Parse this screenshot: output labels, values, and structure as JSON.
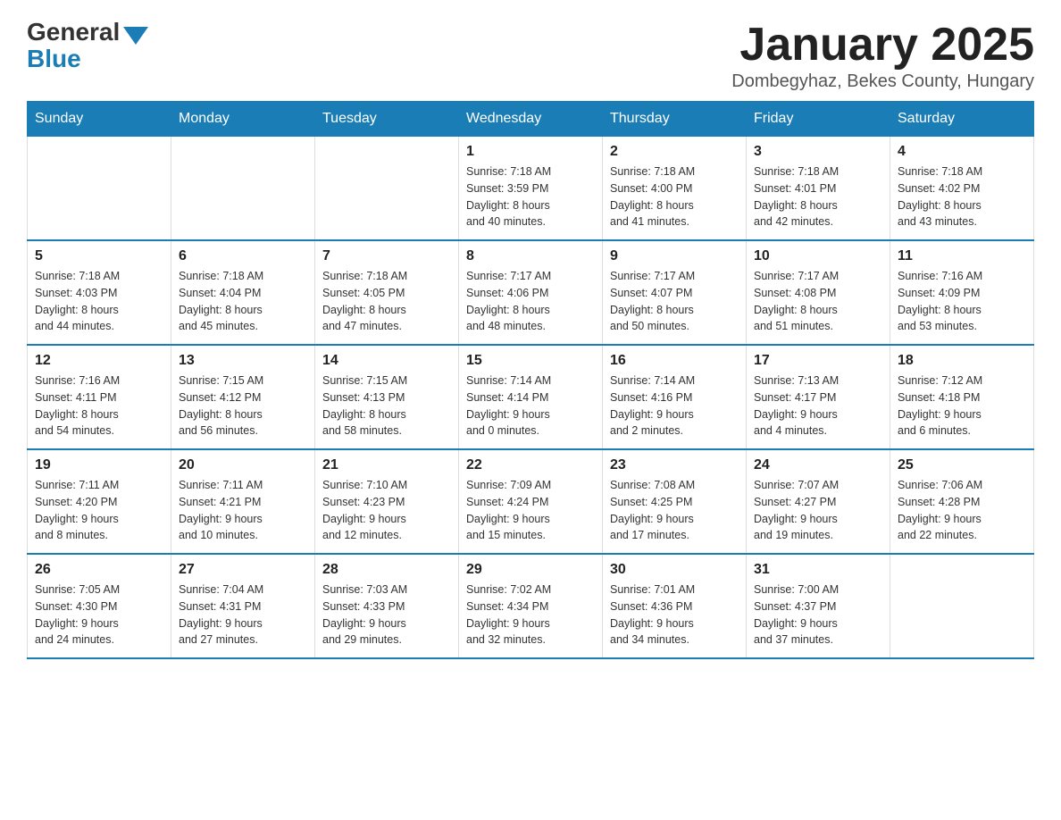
{
  "header": {
    "logo_general": "General",
    "logo_blue": "Blue",
    "title": "January 2025",
    "location": "Dombegyhaz, Bekes County, Hungary"
  },
  "days_of_week": [
    "Sunday",
    "Monday",
    "Tuesday",
    "Wednesday",
    "Thursday",
    "Friday",
    "Saturday"
  ],
  "weeks": [
    [
      {
        "day": "",
        "info": ""
      },
      {
        "day": "",
        "info": ""
      },
      {
        "day": "",
        "info": ""
      },
      {
        "day": "1",
        "info": "Sunrise: 7:18 AM\nSunset: 3:59 PM\nDaylight: 8 hours\nand 40 minutes."
      },
      {
        "day": "2",
        "info": "Sunrise: 7:18 AM\nSunset: 4:00 PM\nDaylight: 8 hours\nand 41 minutes."
      },
      {
        "day": "3",
        "info": "Sunrise: 7:18 AM\nSunset: 4:01 PM\nDaylight: 8 hours\nand 42 minutes."
      },
      {
        "day": "4",
        "info": "Sunrise: 7:18 AM\nSunset: 4:02 PM\nDaylight: 8 hours\nand 43 minutes."
      }
    ],
    [
      {
        "day": "5",
        "info": "Sunrise: 7:18 AM\nSunset: 4:03 PM\nDaylight: 8 hours\nand 44 minutes."
      },
      {
        "day": "6",
        "info": "Sunrise: 7:18 AM\nSunset: 4:04 PM\nDaylight: 8 hours\nand 45 minutes."
      },
      {
        "day": "7",
        "info": "Sunrise: 7:18 AM\nSunset: 4:05 PM\nDaylight: 8 hours\nand 47 minutes."
      },
      {
        "day": "8",
        "info": "Sunrise: 7:17 AM\nSunset: 4:06 PM\nDaylight: 8 hours\nand 48 minutes."
      },
      {
        "day": "9",
        "info": "Sunrise: 7:17 AM\nSunset: 4:07 PM\nDaylight: 8 hours\nand 50 minutes."
      },
      {
        "day": "10",
        "info": "Sunrise: 7:17 AM\nSunset: 4:08 PM\nDaylight: 8 hours\nand 51 minutes."
      },
      {
        "day": "11",
        "info": "Sunrise: 7:16 AM\nSunset: 4:09 PM\nDaylight: 8 hours\nand 53 minutes."
      }
    ],
    [
      {
        "day": "12",
        "info": "Sunrise: 7:16 AM\nSunset: 4:11 PM\nDaylight: 8 hours\nand 54 minutes."
      },
      {
        "day": "13",
        "info": "Sunrise: 7:15 AM\nSunset: 4:12 PM\nDaylight: 8 hours\nand 56 minutes."
      },
      {
        "day": "14",
        "info": "Sunrise: 7:15 AM\nSunset: 4:13 PM\nDaylight: 8 hours\nand 58 minutes."
      },
      {
        "day": "15",
        "info": "Sunrise: 7:14 AM\nSunset: 4:14 PM\nDaylight: 9 hours\nand 0 minutes."
      },
      {
        "day": "16",
        "info": "Sunrise: 7:14 AM\nSunset: 4:16 PM\nDaylight: 9 hours\nand 2 minutes."
      },
      {
        "day": "17",
        "info": "Sunrise: 7:13 AM\nSunset: 4:17 PM\nDaylight: 9 hours\nand 4 minutes."
      },
      {
        "day": "18",
        "info": "Sunrise: 7:12 AM\nSunset: 4:18 PM\nDaylight: 9 hours\nand 6 minutes."
      }
    ],
    [
      {
        "day": "19",
        "info": "Sunrise: 7:11 AM\nSunset: 4:20 PM\nDaylight: 9 hours\nand 8 minutes."
      },
      {
        "day": "20",
        "info": "Sunrise: 7:11 AM\nSunset: 4:21 PM\nDaylight: 9 hours\nand 10 minutes."
      },
      {
        "day": "21",
        "info": "Sunrise: 7:10 AM\nSunset: 4:23 PM\nDaylight: 9 hours\nand 12 minutes."
      },
      {
        "day": "22",
        "info": "Sunrise: 7:09 AM\nSunset: 4:24 PM\nDaylight: 9 hours\nand 15 minutes."
      },
      {
        "day": "23",
        "info": "Sunrise: 7:08 AM\nSunset: 4:25 PM\nDaylight: 9 hours\nand 17 minutes."
      },
      {
        "day": "24",
        "info": "Sunrise: 7:07 AM\nSunset: 4:27 PM\nDaylight: 9 hours\nand 19 minutes."
      },
      {
        "day": "25",
        "info": "Sunrise: 7:06 AM\nSunset: 4:28 PM\nDaylight: 9 hours\nand 22 minutes."
      }
    ],
    [
      {
        "day": "26",
        "info": "Sunrise: 7:05 AM\nSunset: 4:30 PM\nDaylight: 9 hours\nand 24 minutes."
      },
      {
        "day": "27",
        "info": "Sunrise: 7:04 AM\nSunset: 4:31 PM\nDaylight: 9 hours\nand 27 minutes."
      },
      {
        "day": "28",
        "info": "Sunrise: 7:03 AM\nSunset: 4:33 PM\nDaylight: 9 hours\nand 29 minutes."
      },
      {
        "day": "29",
        "info": "Sunrise: 7:02 AM\nSunset: 4:34 PM\nDaylight: 9 hours\nand 32 minutes."
      },
      {
        "day": "30",
        "info": "Sunrise: 7:01 AM\nSunset: 4:36 PM\nDaylight: 9 hours\nand 34 minutes."
      },
      {
        "day": "31",
        "info": "Sunrise: 7:00 AM\nSunset: 4:37 PM\nDaylight: 9 hours\nand 37 minutes."
      },
      {
        "day": "",
        "info": ""
      }
    ]
  ]
}
